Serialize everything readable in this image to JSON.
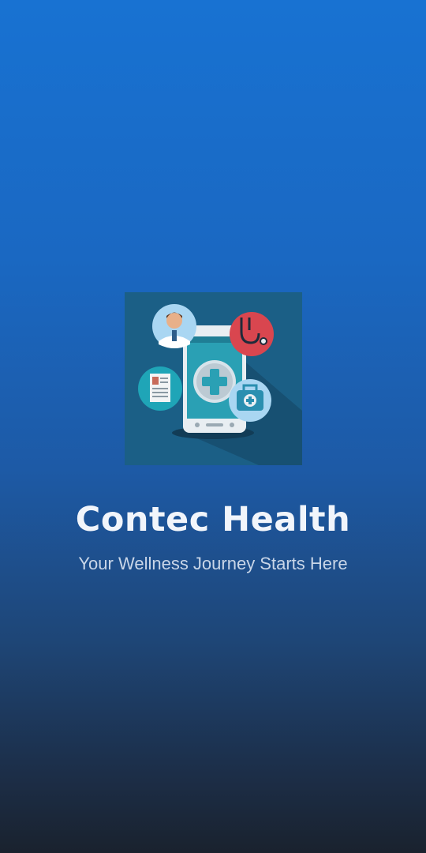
{
  "app": {
    "name": "Contec Health",
    "tagline": "Your Wellness Journey Starts Here"
  },
  "logo": {
    "icon": "health-app-logo",
    "elements": [
      "phone-icon",
      "medical-cross-icon",
      "doctor-avatar-icon",
      "stethoscope-icon",
      "patient-record-icon",
      "medical-bag-icon"
    ]
  },
  "colors": {
    "background_top": "#1872d2",
    "background_bottom": "#1a222e",
    "logo_background": "#1b5f86",
    "title_text": "#f1f5fb",
    "tagline_text": "#c9d6e8",
    "stethoscope_circle": "#d9464f",
    "doctor_circle": "#a9d6f2",
    "record_circle": "#1fa5b7",
    "bag_circle": "#a9d6f2"
  }
}
